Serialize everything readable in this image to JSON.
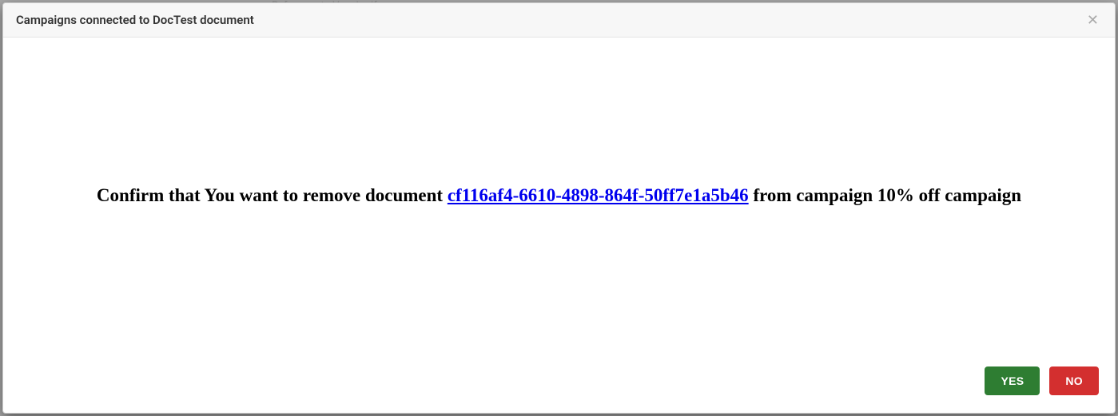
{
  "background": {
    "hint_text": "Reference to Voucherify"
  },
  "modal": {
    "title": "Campaigns connected to DocTest document",
    "confirm": {
      "prefix": "Confirm that You want to remove document ",
      "document_id": "cf116af4-6610-4898-864f-50ff7e1a5b46",
      "middle": " from campaign ",
      "campaign_name": "10% off campaign"
    },
    "buttons": {
      "yes": "YES",
      "no": "NO"
    }
  }
}
